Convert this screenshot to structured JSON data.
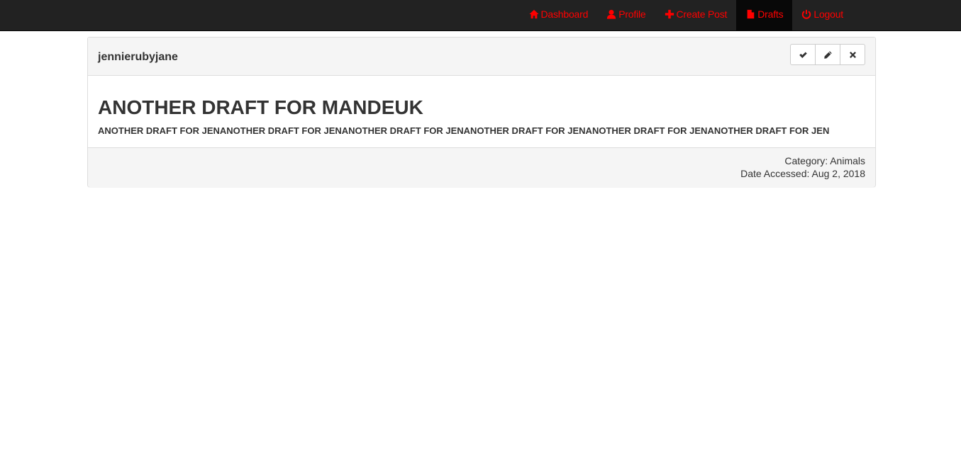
{
  "nav": {
    "items": [
      {
        "label": "Dashboard",
        "icon": "home-icon",
        "active": false
      },
      {
        "label": "Profile",
        "icon": "user-icon",
        "active": false
      },
      {
        "label": "Create Post",
        "icon": "plus-icon",
        "active": false
      },
      {
        "label": "Drafts",
        "icon": "file-icon",
        "active": true
      },
      {
        "label": "Logout",
        "icon": "power-icon",
        "active": false
      }
    ]
  },
  "draft": {
    "author": "jennierubyjane",
    "actions": {
      "approve_icon": "checkmark-icon",
      "edit_icon": "pencil-icon",
      "delete_icon": "close-icon"
    },
    "title": "ANOTHER DRAFT FOR MANDEUK",
    "body": "ANOTHER DRAFT FOR JENANOTHER DRAFT FOR JENANOTHER DRAFT FOR JENANOTHER DRAFT FOR JENANOTHER DRAFT FOR JENANOTHER DRAFT FOR JEN",
    "category": "Category: Animals",
    "date_accessed": "Date Accessed: Aug 2, 2018"
  },
  "colors": {
    "nav_bg": "#222222",
    "nav_active_bg": "#080808",
    "nav_link": "#ff0000",
    "panel_bg": "#f5f5f5",
    "text": "#333333"
  }
}
